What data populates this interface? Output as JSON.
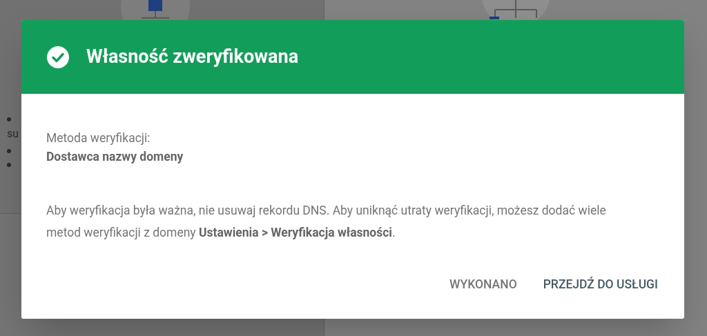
{
  "background": {
    "fragment": "su"
  },
  "dialog": {
    "title": "Własność zweryfikowana",
    "method_label": "Metoda weryfikacji:",
    "method_value": "Dostawca nazwy domeny",
    "message": "Aby weryfikacja była ważna, nie usuwaj rekordu DNS. Aby uniknąć utraty weryfikacji, możesz dodać wiele metod weryfikacji z domeny **Ustawienia > Weryfikacja własności**.",
    "buttons": [
      {
        "label": "WYKONANO",
        "kind": "secondary"
      },
      {
        "label": "PRZEJDŹ DO USŁUGI",
        "kind": "primary"
      }
    ]
  }
}
